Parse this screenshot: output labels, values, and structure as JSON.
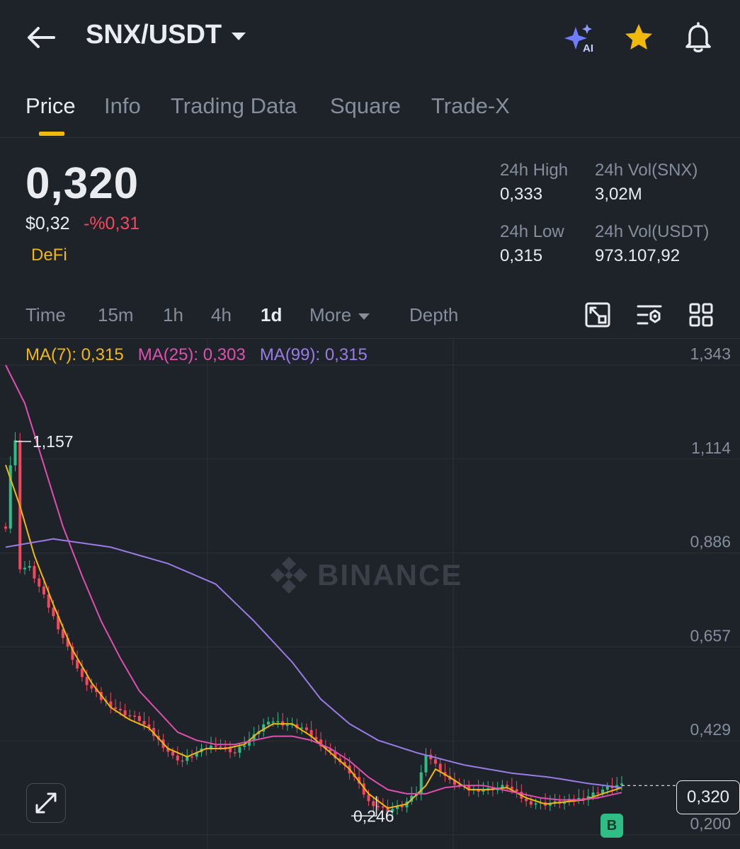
{
  "header": {
    "pair": "SNX/USDT",
    "icons": [
      "back-arrow-icon",
      "ai-sparkle-icon",
      "star-icon",
      "bell-icon"
    ],
    "ai_badge": "AI"
  },
  "tabs": [
    {
      "label": "Price",
      "active": true
    },
    {
      "label": "Info"
    },
    {
      "label": "Trading Data"
    },
    {
      "label": "Square"
    },
    {
      "label": "Trade-X"
    }
  ],
  "ticker": {
    "last_price": "0,320",
    "usd_price": "$0,32",
    "change": "-%0,31",
    "category": "DeFi",
    "high_label": "24h High",
    "high_value": "0,333",
    "vol_snx_label": "24h Vol(SNX)",
    "vol_snx_value": "3,02M",
    "low_label": "24h Low",
    "low_value": "0,315",
    "vol_usdt_label": "24h Vol(USDT)",
    "vol_usdt_value": "973.107,92"
  },
  "intervals": {
    "items": [
      "Time",
      "15m",
      "1h",
      "4h",
      "1d",
      "More",
      "Depth"
    ],
    "active": "1d"
  },
  "ma": {
    "ma7": "MA(7): 0,315",
    "ma25": "MA(25): 0,303",
    "ma99": "MA(99): 0,315"
  },
  "colors": {
    "up": "#2ebd85",
    "down": "#f6465d",
    "accent": "#f0b90b",
    "ma7": "#f0b90b",
    "ma25": "#e04fb0",
    "ma99": "#9b7be6"
  },
  "watermark": "BINANCE",
  "chart_data": {
    "type": "line",
    "y_ticks": [
      "1,343",
      "1,114",
      "0,886",
      "0,657",
      "0,429",
      "0,200"
    ],
    "ylim": [
      0.2,
      1.343
    ],
    "max_label": "1,157",
    "min_label": "0,246",
    "current_price_label": "0,320",
    "buy_marker": "B",
    "x_count": 130,
    "close_keypoints": [
      [
        0,
        0.95
      ],
      [
        1,
        1.1
      ],
      [
        2,
        1.157
      ],
      [
        3,
        0.85
      ],
      [
        5,
        0.85
      ],
      [
        8,
        0.78
      ],
      [
        12,
        0.68
      ],
      [
        16,
        0.58
      ],
      [
        20,
        0.53
      ],
      [
        24,
        0.5
      ],
      [
        28,
        0.48
      ],
      [
        32,
        0.43
      ],
      [
        35,
        0.39
      ],
      [
        37,
        0.38
      ],
      [
        40,
        0.4
      ],
      [
        44,
        0.42
      ],
      [
        48,
        0.4
      ],
      [
        52,
        0.44
      ],
      [
        55,
        0.48
      ],
      [
        58,
        0.47
      ],
      [
        62,
        0.46
      ],
      [
        65,
        0.43
      ],
      [
        69,
        0.39
      ],
      [
        73,
        0.34
      ],
      [
        76,
        0.28
      ],
      [
        80,
        0.26
      ],
      [
        83,
        0.27
      ],
      [
        86,
        0.3
      ],
      [
        88,
        0.4
      ],
      [
        90,
        0.37
      ],
      [
        93,
        0.33
      ],
      [
        97,
        0.31
      ],
      [
        101,
        0.31
      ],
      [
        105,
        0.32
      ],
      [
        109,
        0.28
      ],
      [
        113,
        0.275
      ],
      [
        117,
        0.28
      ],
      [
        121,
        0.29
      ],
      [
        125,
        0.31
      ],
      [
        128,
        0.32
      ],
      [
        129,
        0.32
      ]
    ],
    "series": [
      {
        "name": "MA(7)",
        "keypoints": [
          [
            0,
            1.1
          ],
          [
            3,
            1.0
          ],
          [
            6,
            0.88
          ],
          [
            10,
            0.76
          ],
          [
            14,
            0.65
          ],
          [
            18,
            0.57
          ],
          [
            22,
            0.51
          ],
          [
            26,
            0.48
          ],
          [
            30,
            0.46
          ],
          [
            34,
            0.41
          ],
          [
            38,
            0.39
          ],
          [
            42,
            0.41
          ],
          [
            46,
            0.41
          ],
          [
            50,
            0.42
          ],
          [
            53,
            0.45
          ],
          [
            56,
            0.47
          ],
          [
            60,
            0.47
          ],
          [
            64,
            0.44
          ],
          [
            68,
            0.4
          ],
          [
            72,
            0.36
          ],
          [
            76,
            0.3
          ],
          [
            80,
            0.265
          ],
          [
            84,
            0.275
          ],
          [
            88,
            0.32
          ],
          [
            90,
            0.36
          ],
          [
            93,
            0.34
          ],
          [
            97,
            0.31
          ],
          [
            101,
            0.31
          ],
          [
            105,
            0.315
          ],
          [
            109,
            0.29
          ],
          [
            113,
            0.275
          ],
          [
            117,
            0.28
          ],
          [
            121,
            0.285
          ],
          [
            125,
            0.3
          ],
          [
            129,
            0.315
          ]
        ]
      },
      {
        "name": "MA(25)",
        "keypoints": [
          [
            0,
            1.343
          ],
          [
            4,
            1.25
          ],
          [
            8,
            1.1
          ],
          [
            12,
            0.95
          ],
          [
            16,
            0.83
          ],
          [
            20,
            0.72
          ],
          [
            24,
            0.63
          ],
          [
            28,
            0.55
          ],
          [
            32,
            0.5
          ],
          [
            36,
            0.45
          ],
          [
            40,
            0.43
          ],
          [
            44,
            0.42
          ],
          [
            48,
            0.42
          ],
          [
            52,
            0.43
          ],
          [
            56,
            0.44
          ],
          [
            60,
            0.44
          ],
          [
            64,
            0.43
          ],
          [
            68,
            0.41
          ],
          [
            72,
            0.38
          ],
          [
            76,
            0.34
          ],
          [
            80,
            0.31
          ],
          [
            84,
            0.3
          ],
          [
            88,
            0.3
          ],
          [
            92,
            0.315
          ],
          [
            96,
            0.32
          ],
          [
            100,
            0.32
          ],
          [
            104,
            0.31
          ],
          [
            108,
            0.3
          ],
          [
            112,
            0.29
          ],
          [
            116,
            0.285
          ],
          [
            120,
            0.285
          ],
          [
            124,
            0.29
          ],
          [
            129,
            0.303
          ]
        ]
      },
      {
        "name": "MA(99)",
        "keypoints": [
          [
            0,
            0.9
          ],
          [
            10,
            0.92
          ],
          [
            22,
            0.9
          ],
          [
            34,
            0.86
          ],
          [
            44,
            0.81
          ],
          [
            52,
            0.72
          ],
          [
            60,
            0.62
          ],
          [
            66,
            0.53
          ],
          [
            72,
            0.47
          ],
          [
            78,
            0.43
          ],
          [
            86,
            0.4
          ],
          [
            96,
            0.37
          ],
          [
            106,
            0.35
          ],
          [
            114,
            0.34
          ],
          [
            122,
            0.325
          ],
          [
            129,
            0.315
          ]
        ]
      }
    ]
  }
}
